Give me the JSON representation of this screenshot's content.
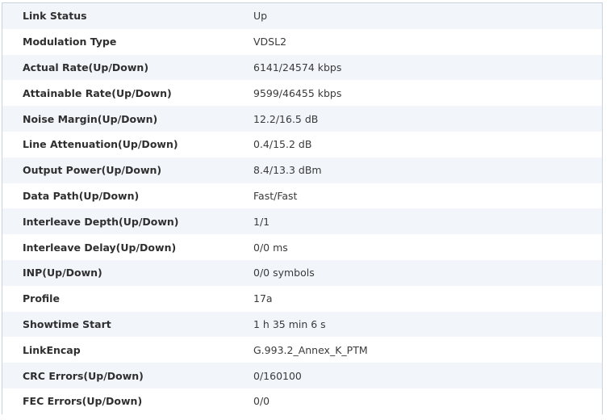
{
  "dsl_status": {
    "rows": [
      {
        "label": "Link Status",
        "value": "Up"
      },
      {
        "label": "Modulation Type",
        "value": "VDSL2"
      },
      {
        "label": "Actual Rate(Up/Down)",
        "value": "6141/24574 kbps"
      },
      {
        "label": "Attainable Rate(Up/Down)",
        "value": "9599/46455 kbps"
      },
      {
        "label": "Noise Margin(Up/Down)",
        "value": "12.2/16.5 dB"
      },
      {
        "label": "Line Attenuation(Up/Down)",
        "value": "0.4/15.2 dB"
      },
      {
        "label": "Output Power(Up/Down)",
        "value": "8.4/13.3 dBm"
      },
      {
        "label": "Data Path(Up/Down)",
        "value": "Fast/Fast"
      },
      {
        "label": "Interleave Depth(Up/Down)",
        "value": "1/1"
      },
      {
        "label": "Interleave Delay(Up/Down)",
        "value": "0/0 ms"
      },
      {
        "label": "INP(Up/Down)",
        "value": "0/0 symbols"
      },
      {
        "label": "Profile",
        "value": "17a"
      },
      {
        "label": "Showtime Start",
        "value": "1 h 35 min 6 s"
      },
      {
        "label": "LinkEncap",
        "value": "G.993.2_Annex_K_PTM"
      },
      {
        "label": "CRC Errors(Up/Down)",
        "value": "0/160100"
      },
      {
        "label": "FEC Errors(Up/Down)",
        "value": "0/0"
      }
    ]
  },
  "colors": {
    "row_alt": "#f2f6fb",
    "row_base": "#ffffff",
    "border": "#c9d3dd"
  }
}
